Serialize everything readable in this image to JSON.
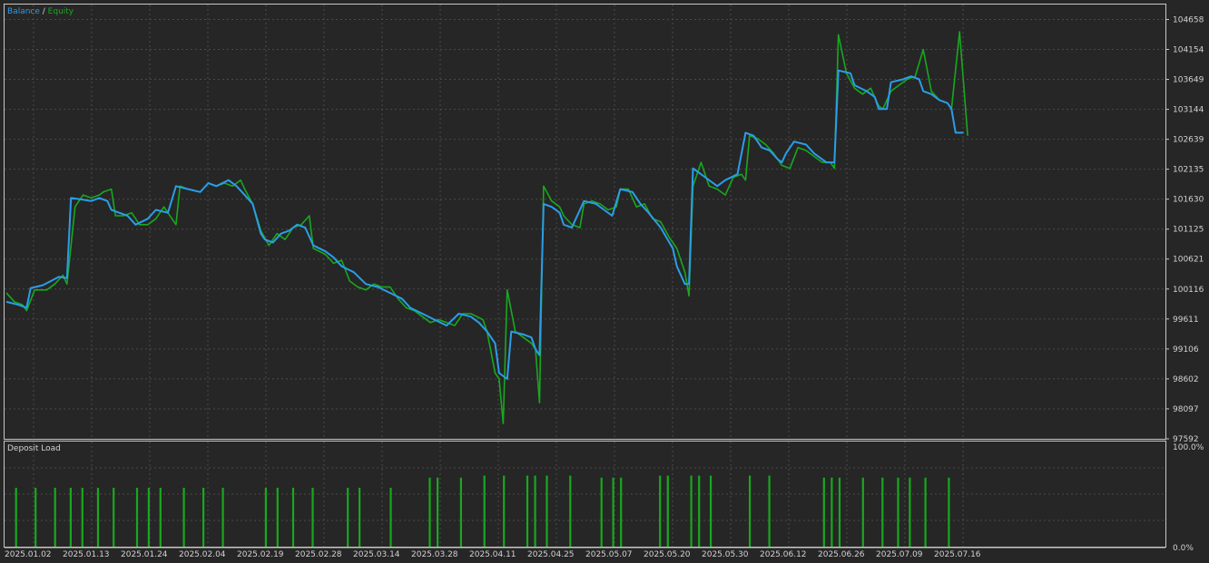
{
  "colors": {
    "background": "#262626",
    "frame": "#c8c8c8",
    "grid": "#4a4a4a",
    "text": "#d2d2d2",
    "balance": "#2b9de8",
    "equity": "#18a81e",
    "deposit_bar": "#18a81e"
  },
  "chart_data": [
    {
      "type": "line",
      "legend": {
        "balance_label": "Balance",
        "separator": " / ",
        "equity_label": "Equity",
        "placement": "top-left"
      },
      "grid": true,
      "y_ticks": [
        "104658",
        "104154",
        "103649",
        "103144",
        "102639",
        "102135",
        "101630",
        "101125",
        "100621",
        "100116",
        "99611",
        "99106",
        "98602",
        "98097",
        "97592"
      ],
      "ylim": [
        97592,
        104910
      ],
      "x_ticks": [
        "2025.01.02",
        "2025.01.13",
        "2025.01.24",
        "2025.02.04",
        "2025.02.19",
        "2025.02.28",
        "2025.03.14",
        "2025.03.28",
        "2025.04.11",
        "2025.04.25",
        "2025.05.07",
        "2025.05.20",
        "2025.05.30",
        "2025.06.12",
        "2025.06.26",
        "2025.07.09",
        "2025.07.16"
      ],
      "x_index_range": [
        0,
        199
      ],
      "series": [
        {
          "name": "Balance",
          "points": [
            [
              0,
              99900
            ],
            [
              3,
              99850
            ],
            [
              5,
              99800
            ],
            [
              6,
              100130
            ],
            [
              9,
              100180
            ],
            [
              11,
              100250
            ],
            [
              13,
              100320
            ],
            [
              15,
              100300
            ],
            [
              16,
              101650
            ],
            [
              19,
              101620
            ],
            [
              21,
              101600
            ],
            [
              23,
              101650
            ],
            [
              25,
              101600
            ],
            [
              26,
              101450
            ],
            [
              30,
              101350
            ],
            [
              32,
              101200
            ],
            [
              35,
              101300
            ],
            [
              37,
              101450
            ],
            [
              40,
              101400
            ],
            [
              42,
              101850
            ],
            [
              45,
              101800
            ],
            [
              48,
              101750
            ],
            [
              50,
              101900
            ],
            [
              52,
              101850
            ],
            [
              55,
              101950
            ],
            [
              57,
              101850
            ],
            [
              59,
              101700
            ],
            [
              61,
              101550
            ],
            [
              63,
              101050
            ],
            [
              64,
              100950
            ],
            [
              66,
              100900
            ],
            [
              68,
              101050
            ],
            [
              70,
              101100
            ],
            [
              72,
              101200
            ],
            [
              74,
              101150
            ],
            [
              76,
              100850
            ],
            [
              79,
              100750
            ],
            [
              81,
              100650
            ],
            [
              83,
              100500
            ],
            [
              86,
              100400
            ],
            [
              89,
              100200
            ],
            [
              92,
              100150
            ],
            [
              95,
              100050
            ],
            [
              98,
              99950
            ],
            [
              100,
              99800
            ],
            [
              103,
              99700
            ],
            [
              106,
              99600
            ],
            [
              109,
              99500
            ],
            [
              112,
              99700
            ],
            [
              115,
              99650
            ],
            [
              117,
              99550
            ],
            [
              119,
              99400
            ],
            [
              121,
              99200
            ],
            [
              122,
              98700
            ],
            [
              124,
              98600
            ],
            [
              125,
              99400
            ],
            [
              128,
              99350
            ],
            [
              130,
              99300
            ],
            [
              131,
              99100
            ],
            [
              132,
              99000
            ],
            [
              133,
              101550
            ],
            [
              135,
              101500
            ],
            [
              137,
              101400
            ],
            [
              138,
              101200
            ],
            [
              140,
              101150
            ],
            [
              143,
              101600
            ],
            [
              146,
              101550
            ],
            [
              148,
              101450
            ],
            [
              150,
              101350
            ],
            [
              152,
              101800
            ],
            [
              155,
              101750
            ],
            [
              157,
              101550
            ],
            [
              159,
              101400
            ],
            [
              162,
              101150
            ],
            [
              165,
              100800
            ],
            [
              166,
              100500
            ],
            [
              168,
              100200
            ],
            [
              169,
              100200
            ],
            [
              170,
              102150
            ],
            [
              173,
              102000
            ],
            [
              176,
              101850
            ],
            [
              178,
              101950
            ],
            [
              181,
              102050
            ],
            [
              183,
              102750
            ],
            [
              185,
              102700
            ],
            [
              187,
              102500
            ],
            [
              189,
              102450
            ],
            [
              191,
              102300
            ],
            [
              192,
              102250
            ],
            [
              193,
              102400
            ],
            [
              195,
              102600
            ],
            [
              198,
              102550
            ],
            [
              200,
              102400
            ],
            [
              203,
              102250
            ],
            [
              205,
              102250
            ],
            [
              206,
              103800
            ],
            [
              209,
              103750
            ],
            [
              210,
              103550
            ],
            [
              213,
              103450
            ],
            [
              215,
              103350
            ],
            [
              216,
              103150
            ],
            [
              218,
              103150
            ],
            [
              219,
              103600
            ],
            [
              222,
              103650
            ],
            [
              224,
              103700
            ],
            [
              226,
              103650
            ],
            [
              227,
              103450
            ],
            [
              229,
              103400
            ],
            [
              231,
              103300
            ],
            [
              233,
              103250
            ],
            [
              234,
              103150
            ],
            [
              235,
              102750
            ],
            [
              237,
              102750
            ]
          ]
        },
        {
          "name": "Equity",
          "points": [
            [
              0,
              100050
            ],
            [
              2,
              99900
            ],
            [
              4,
              99850
            ],
            [
              5,
              99750
            ],
            [
              7,
              100100
            ],
            [
              10,
              100100
            ],
            [
              12,
              100200
            ],
            [
              14,
              100350
            ],
            [
              15,
              100200
            ],
            [
              17,
              101500
            ],
            [
              19,
              101700
            ],
            [
              21,
              101650
            ],
            [
              23,
              101700
            ],
            [
              24,
              101750
            ],
            [
              26,
              101800
            ],
            [
              27,
              101350
            ],
            [
              29,
              101350
            ],
            [
              31,
              101400
            ],
            [
              33,
              101200
            ],
            [
              35,
              101200
            ],
            [
              37,
              101300
            ],
            [
              39,
              101500
            ],
            [
              40,
              101400
            ],
            [
              42,
              101200
            ],
            [
              43,
              101850
            ],
            [
              45,
              101800
            ],
            [
              48,
              101750
            ],
            [
              50,
              101900
            ],
            [
              52,
              101850
            ],
            [
              54,
              101900
            ],
            [
              56,
              101850
            ],
            [
              58,
              101950
            ],
            [
              59,
              101800
            ],
            [
              61,
              101550
            ],
            [
              63,
              101100
            ],
            [
              65,
              100850
            ],
            [
              67,
              101050
            ],
            [
              69,
              100950
            ],
            [
              71,
              101150
            ],
            [
              73,
              101200
            ],
            [
              75,
              101350
            ],
            [
              76,
              100800
            ],
            [
              79,
              100700
            ],
            [
              81,
              100550
            ],
            [
              83,
              100600
            ],
            [
              85,
              100250
            ],
            [
              87,
              100150
            ],
            [
              89,
              100100
            ],
            [
              91,
              100200
            ],
            [
              93,
              100150
            ],
            [
              95,
              100150
            ],
            [
              97,
              99950
            ],
            [
              99,
              99800
            ],
            [
              101,
              99750
            ],
            [
              103,
              99650
            ],
            [
              105,
              99550
            ],
            [
              107,
              99600
            ],
            [
              109,
              99550
            ],
            [
              111,
              99500
            ],
            [
              113,
              99700
            ],
            [
              115,
              99700
            ],
            [
              118,
              99600
            ],
            [
              119,
              99400
            ],
            [
              121,
              98700
            ],
            [
              122,
              98600
            ],
            [
              123,
              97850
            ],
            [
              124,
              100100
            ],
            [
              126,
              99400
            ],
            [
              128,
              99300
            ],
            [
              130,
              99200
            ],
            [
              131,
              99100
            ],
            [
              132,
              98200
            ],
            [
              133,
              101850
            ],
            [
              135,
              101600
            ],
            [
              137,
              101500
            ],
            [
              138,
              101350
            ],
            [
              140,
              101200
            ],
            [
              142,
              101150
            ],
            [
              143,
              101550
            ],
            [
              145,
              101600
            ],
            [
              147,
              101550
            ],
            [
              149,
              101450
            ],
            [
              151,
              101500
            ],
            [
              152,
              101800
            ],
            [
              154,
              101800
            ],
            [
              156,
              101500
            ],
            [
              158,
              101550
            ],
            [
              160,
              101300
            ],
            [
              162,
              101250
            ],
            [
              164,
              101000
            ],
            [
              166,
              100800
            ],
            [
              168,
              100400
            ],
            [
              169,
              100000
            ],
            [
              170,
              101850
            ],
            [
              172,
              102250
            ],
            [
              174,
              101850
            ],
            [
              176,
              101800
            ],
            [
              178,
              101700
            ],
            [
              180,
              102000
            ],
            [
              182,
              102050
            ],
            [
              183,
              101950
            ],
            [
              184,
              102700
            ],
            [
              186,
              102650
            ],
            [
              188,
              102550
            ],
            [
              190,
              102400
            ],
            [
              192,
              102200
            ],
            [
              194,
              102150
            ],
            [
              196,
              102500
            ],
            [
              198,
              102450
            ],
            [
              200,
              102350
            ],
            [
              202,
              102250
            ],
            [
              204,
              102250
            ],
            [
              205,
              102150
            ],
            [
              206,
              104400
            ],
            [
              208,
              103750
            ],
            [
              210,
              103500
            ],
            [
              212,
              103400
            ],
            [
              214,
              103500
            ],
            [
              216,
              103200
            ],
            [
              217,
              103150
            ],
            [
              219,
              103450
            ],
            [
              221,
              103550
            ],
            [
              223,
              103650
            ],
            [
              225,
              103700
            ],
            [
              227,
              104150
            ],
            [
              229,
              103450
            ],
            [
              231,
              103300
            ],
            [
              233,
              103250
            ],
            [
              234,
              103150
            ],
            [
              236,
              104450
            ],
            [
              238,
              102700
            ]
          ]
        }
      ]
    },
    {
      "type": "bar",
      "title": "Deposit Load",
      "y_ticks": [
        "100.0%",
        "0.0%"
      ],
      "ylim": [
        0,
        100
      ],
      "series": [
        {
          "name": "Deposit Load",
          "x": [
            2,
            7,
            12,
            16,
            19,
            23,
            27,
            33,
            36,
            39,
            45,
            50,
            55,
            66,
            69,
            73,
            78,
            87,
            90,
            98,
            108,
            110,
            116,
            122,
            127,
            133,
            135,
            138,
            144,
            152,
            155,
            157,
            167,
            169,
            175,
            177,
            180,
            190,
            195,
            209,
            211,
            213,
            219,
            224,
            228,
            231,
            235,
            241
          ],
          "values": [
            58,
            58,
            58,
            58,
            58,
            58,
            58,
            58,
            58,
            58,
            58,
            58,
            58,
            58,
            58,
            58,
            58,
            58,
            58,
            58,
            68,
            68,
            68,
            70,
            70,
            70,
            70,
            70,
            70,
            68,
            68,
            68,
            70,
            70,
            70,
            70,
            70,
            70,
            70,
            68,
            68,
            68,
            68,
            68,
            68,
            68,
            68,
            68
          ]
        }
      ]
    }
  ]
}
